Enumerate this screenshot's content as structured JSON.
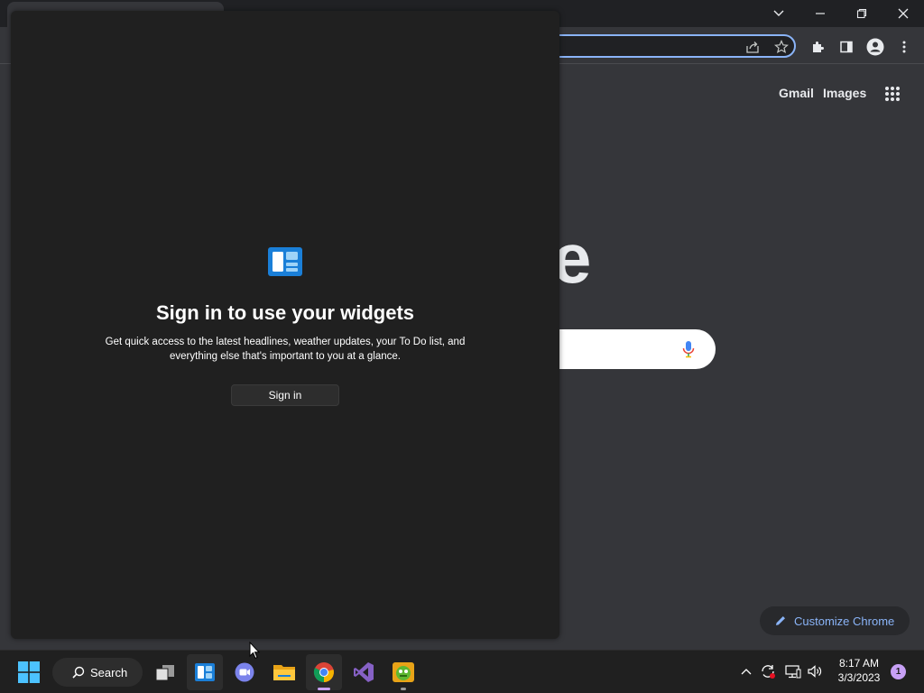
{
  "chrome": {
    "ntp_links": {
      "gmail": "Gmail",
      "images": "Images"
    },
    "logo_partial": "e",
    "customize_label": "Customize Chrome"
  },
  "widgets": {
    "title": "Sign in to use your widgets",
    "description": "Get quick access to the latest headlines, weather updates, your To Do list, and everything else that's important to you at a glance.",
    "signin_label": "Sign in"
  },
  "taskbar": {
    "search_label": "Search",
    "apps": [
      "start",
      "search",
      "task-view",
      "widgets",
      "teams-chat",
      "file-explorer",
      "chrome",
      "visual-studio",
      "green-app"
    ],
    "clock": {
      "time": "8:17 AM",
      "date": "3/3/2023"
    },
    "notification_count": "1"
  },
  "colors": {
    "accent": "#8ab4f8",
    "indicator": "#c7a0f5",
    "panel_bg": "#202020",
    "chrome_bg": "#35363a"
  }
}
